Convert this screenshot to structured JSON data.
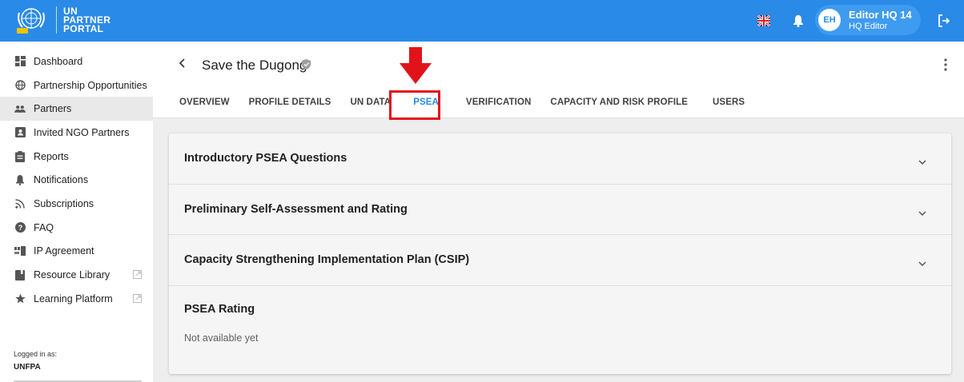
{
  "logo": {
    "line1": "UN",
    "line2": "PARTNER",
    "line3": "PORTAL"
  },
  "user": {
    "initials": "EH",
    "name": "Editor HQ 14",
    "role": "HQ Editor"
  },
  "sidebar": {
    "items": [
      {
        "label": "Dashboard",
        "icon": "dashboard-icon"
      },
      {
        "label": "Partnership Opportunities",
        "icon": "globe-icon"
      },
      {
        "label": "Partners",
        "icon": "people-icon",
        "active": true
      },
      {
        "label": "Invited NGO Partners",
        "icon": "contact-card-icon"
      },
      {
        "label": "Reports",
        "icon": "clipboard-icon"
      },
      {
        "label": "Notifications",
        "icon": "bell-icon"
      },
      {
        "label": "Subscriptions",
        "icon": "rss-icon"
      },
      {
        "label": "FAQ",
        "icon": "help-icon"
      },
      {
        "label": "IP Agreement",
        "icon": "agreement-icon"
      },
      {
        "label": "Resource Library",
        "icon": "book-icon"
      },
      {
        "label": "Learning Platform",
        "icon": "star-icon"
      }
    ],
    "logged_in_label": "Logged in as:",
    "logged_in_org": "UNFPA"
  },
  "page": {
    "title": "Save the Dugong",
    "tabs": [
      "OVERVIEW",
      "PROFILE DETAILS",
      "UN DATA",
      "PSEA",
      "VERIFICATION",
      "CAPACITY AND RISK PROFILE",
      "USERS"
    ],
    "active_tab": "PSEA"
  },
  "panels": [
    "Introductory PSEA Questions",
    "Preliminary Self-Assessment and Rating",
    "Capacity Strengthening Implementation Plan (CSIP)"
  ],
  "rating": {
    "title": "PSEA Rating",
    "value": "Not available yet"
  },
  "colors": {
    "primary": "#2a8ae8",
    "annotation": "#e2121b"
  }
}
